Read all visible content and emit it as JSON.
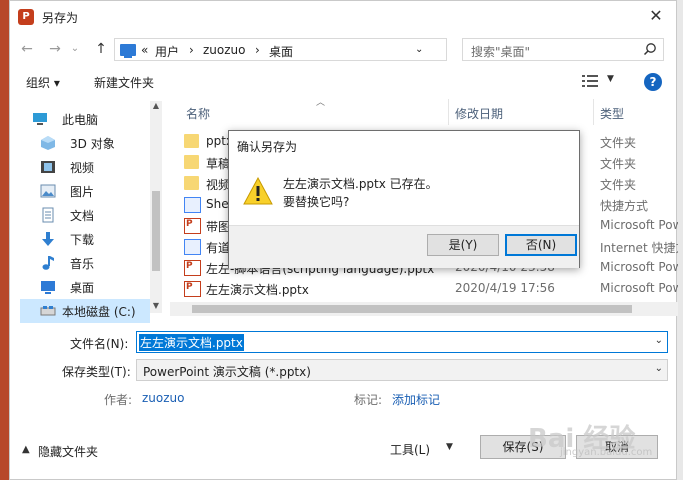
{
  "window": {
    "title": "另存为"
  },
  "nav": {
    "back": "←",
    "forward": "→",
    "recent": "⌄",
    "up": "↑"
  },
  "address": {
    "crumbs": [
      "«",
      "用户",
      "›",
      "zuozuo",
      "›",
      "桌面",
      "⌄"
    ]
  },
  "search": {
    "placeholder": "搜索\"桌面\""
  },
  "toolbar": {
    "organize": "组织 ▾",
    "new_folder": "新建文件夹"
  },
  "sidebar": {
    "items": [
      {
        "label": "此电脑",
        "icon": "computer-icon"
      },
      {
        "label": "3D 对象",
        "icon": "cube-icon"
      },
      {
        "label": "视频",
        "icon": "video-icon"
      },
      {
        "label": "图片",
        "icon": "picture-icon"
      },
      {
        "label": "文档",
        "icon": "document-icon"
      },
      {
        "label": "下载",
        "icon": "download-icon"
      },
      {
        "label": "音乐",
        "icon": "music-icon"
      },
      {
        "label": "桌面",
        "icon": "desktop-icon"
      },
      {
        "label": "本地磁盘 (C:)",
        "icon": "drive-icon"
      }
    ]
  },
  "columns": {
    "name": "名称",
    "date": "修改日期",
    "type": "类型"
  },
  "files": [
    {
      "name": "pptx",
      "date": "",
      "type": "文件夹",
      "kind": "folder"
    },
    {
      "name": "草稿",
      "date": "",
      "type": "文件夹",
      "kind": "folder"
    },
    {
      "name": "视频",
      "date": "",
      "type": "文件夹",
      "kind": "folder"
    },
    {
      "name": "Shel",
      "date": "",
      "type": "快捷方式",
      "kind": "shortcut"
    },
    {
      "name": "带图",
      "date": "",
      "type": "Microsoft Pow",
      "kind": "pptx"
    },
    {
      "name": "有道",
      "date": "",
      "type": "Internet 快捷方",
      "kind": "shortcut"
    },
    {
      "name": "左左-脚本语言(scripting language).pptx",
      "date": "2020/4/10 23:58",
      "type": "Microsoft Pow",
      "kind": "pptx"
    },
    {
      "name": "左左演示文档.pptx",
      "date": "2020/4/19 17:56",
      "type": "Microsoft Pow",
      "kind": "pptx"
    }
  ],
  "form": {
    "filename_label": "文件名(N):",
    "filename_value": "左左演示文档.pptx",
    "filetype_label": "保存类型(T):",
    "filetype_value": "PowerPoint 演示文稿 (*.pptx)",
    "author_label": "作者:",
    "author_value": "zuozuo",
    "tags_label": "标记:",
    "tags_value": "添加标记"
  },
  "footer": {
    "hide_folders": "隐藏文件夹",
    "tools": "工具(L)",
    "save": "保存(S)",
    "cancel": "取消"
  },
  "confirm": {
    "title": "确认另存为",
    "line1": "左左演示文档.pptx 已存在。",
    "line2": "要替换它吗?",
    "yes": "是(Y)",
    "no": "否(N)"
  },
  "watermark": {
    "text": "Bai 经验",
    "sub": "jingyan.baidu.com"
  },
  "colors": {
    "accent": "#0078d7",
    "ppt": "#c43e1c",
    "selected": "#cce8ff"
  }
}
